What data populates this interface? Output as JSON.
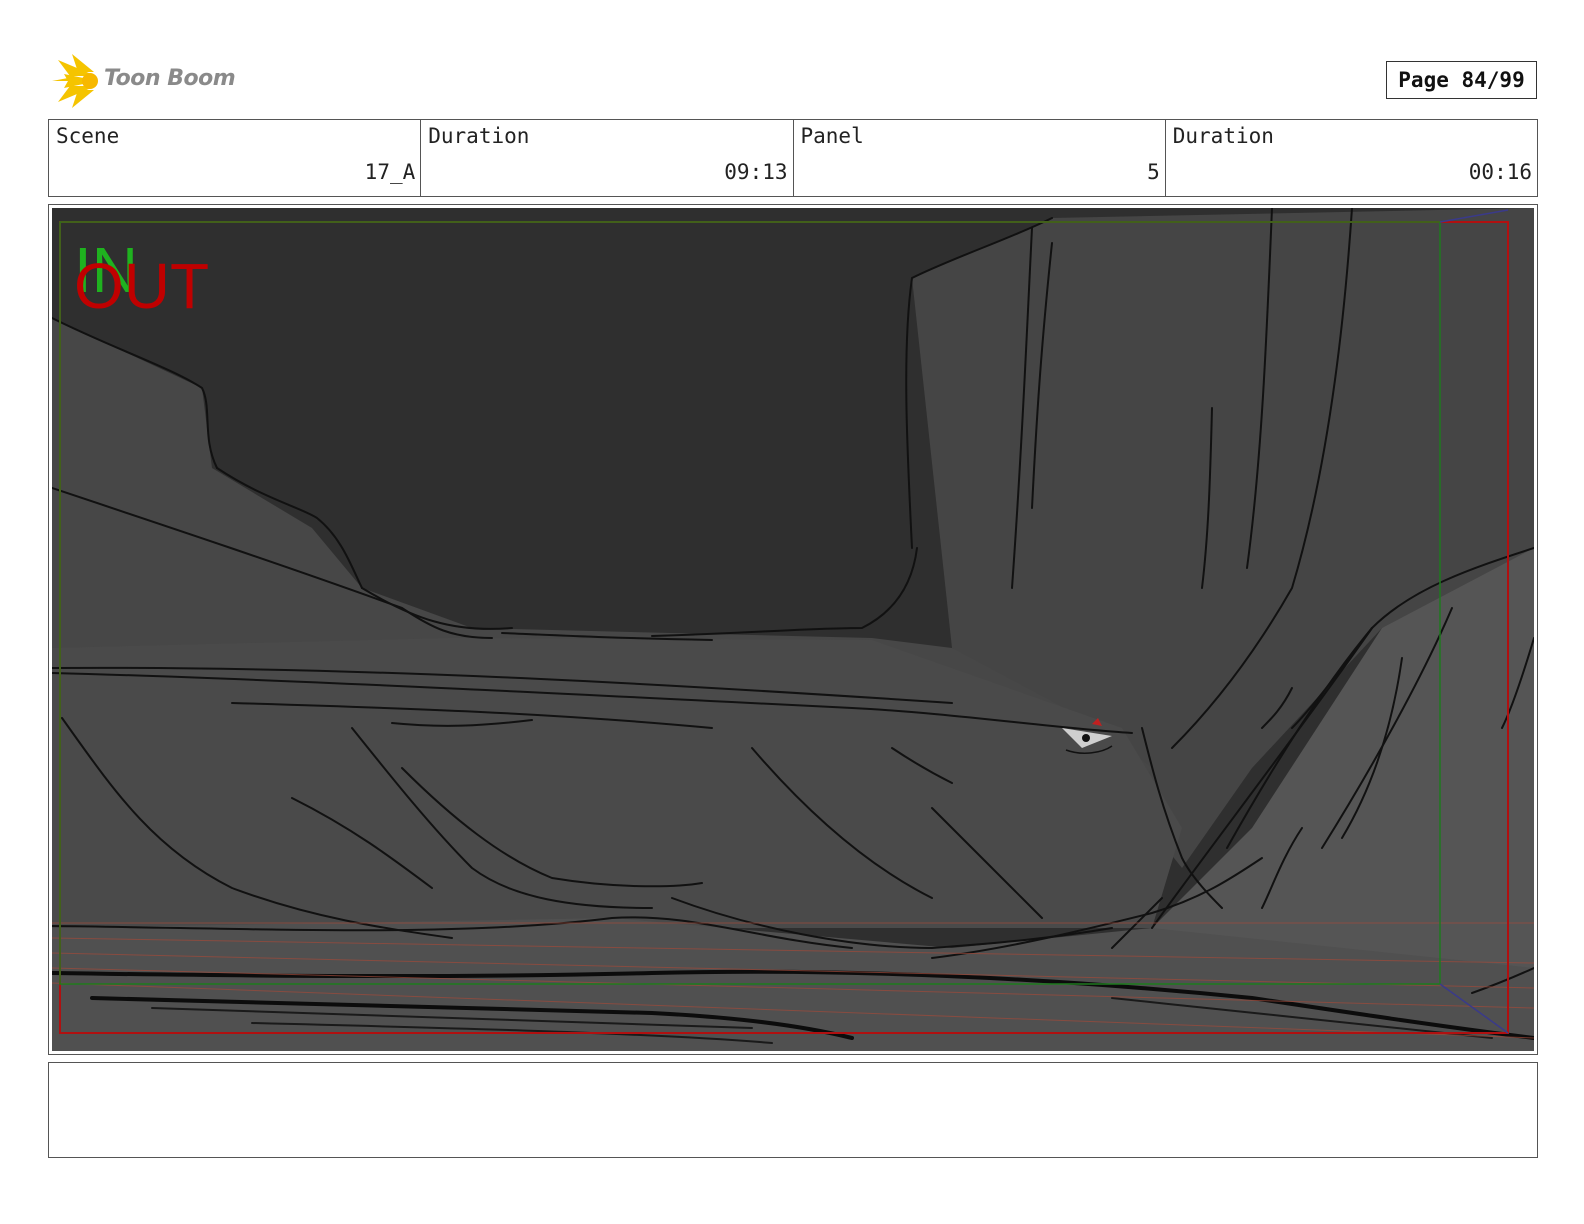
{
  "header": {
    "logo_text": "Toon Boom",
    "page_label": "Page 84/99"
  },
  "info": {
    "scene_label": "Scene",
    "scene_value": "17_A",
    "scene_duration_label": "Duration",
    "scene_duration_value": "09:13",
    "panel_label": "Panel",
    "panel_value": "5",
    "panel_duration_label": "Duration",
    "panel_duration_value": "00:16"
  },
  "panel": {
    "in_marker": "IN",
    "out_marker": "OUT",
    "colors": {
      "in": "#1fb21f",
      "out": "#c00000",
      "sky": "#2f2f2f",
      "canyon": "#474747",
      "safe_frame": "#b01010",
      "action_frame": "#1e7a1e"
    }
  },
  "notes": {
    "text": ""
  }
}
